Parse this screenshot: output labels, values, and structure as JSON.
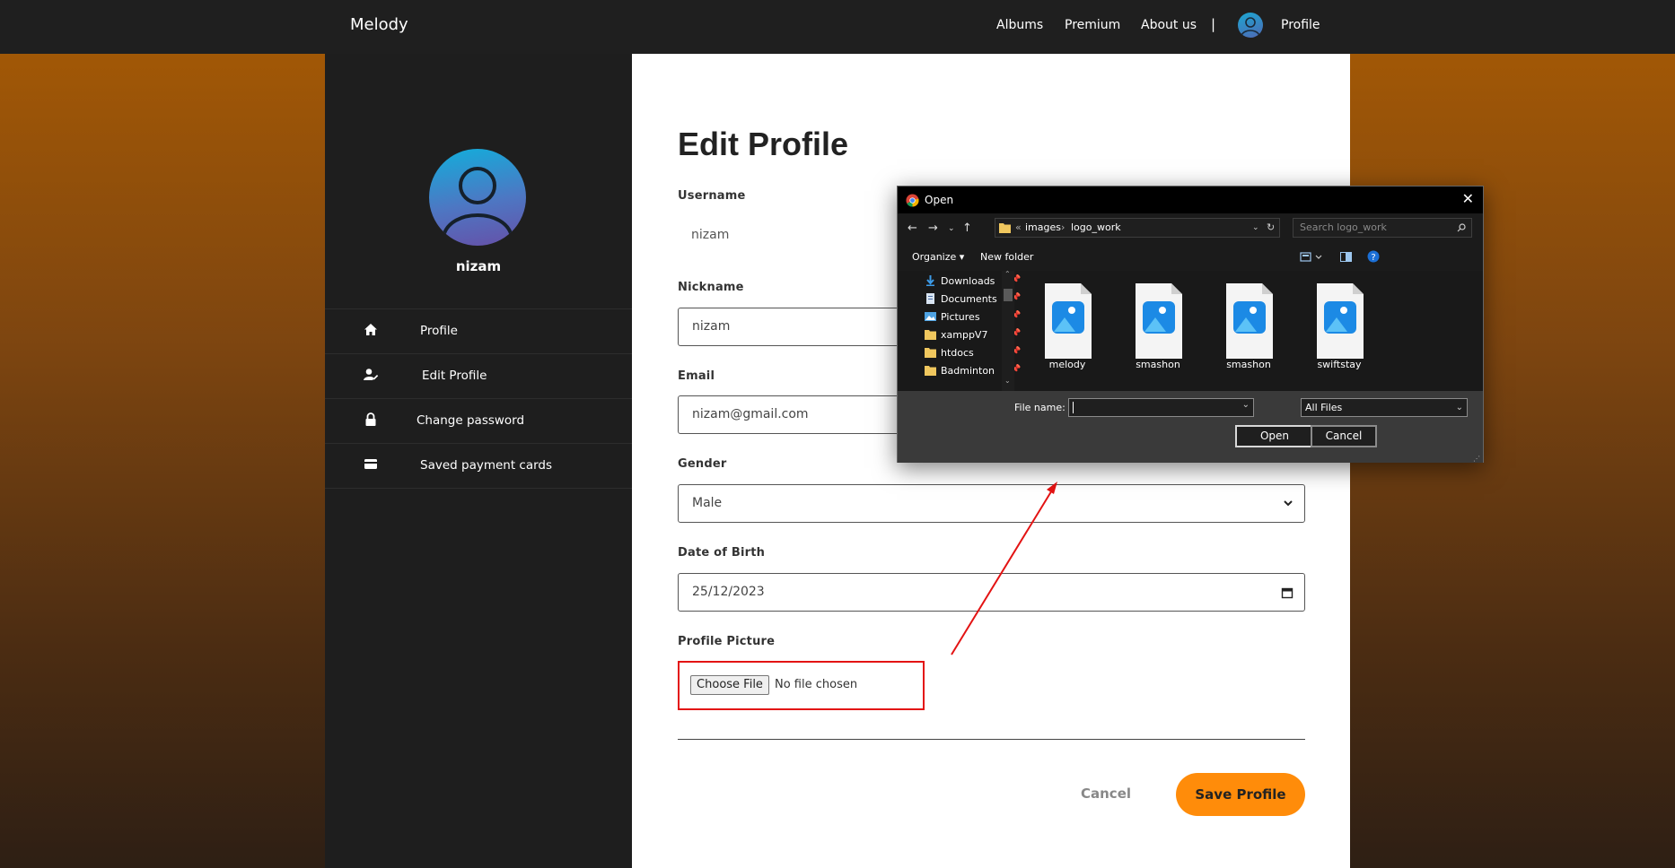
{
  "navbar": {
    "brand": "Melody",
    "links": [
      "Albums",
      "Premium",
      "About us"
    ],
    "separator": "|",
    "profile_label": "Profile"
  },
  "sidebar": {
    "username": "nizam",
    "menu": [
      {
        "label": "Profile",
        "icon": "home-icon"
      },
      {
        "label": "Edit Profile",
        "icon": "user-edit-icon"
      },
      {
        "label": "Change password",
        "icon": "lock-icon"
      },
      {
        "label": "Saved payment cards",
        "icon": "card-icon"
      }
    ]
  },
  "form": {
    "title": "Edit Profile",
    "username_label": "Username",
    "username_value": "nizam",
    "nickname_label": "Nickname",
    "nickname_value": "nizam",
    "email_label": "Email",
    "email_value": "nizam@gmail.com",
    "gender_label": "Gender",
    "gender_value": "Male",
    "dob_label": "Date of Birth",
    "dob_value": "25/12/2023",
    "picture_label": "Profile Picture",
    "choose_file": "Choose File",
    "file_status": "No file chosen",
    "cancel": "Cancel",
    "save": "Save Profile"
  },
  "dialog": {
    "title": "Open",
    "breadcrumb": [
      "«",
      "images",
      "›",
      "logo_work"
    ],
    "search_placeholder": "Search logo_work",
    "organize": "Organize ▾",
    "new_folder": "New folder",
    "tree": [
      {
        "label": "Downloads",
        "icon": "download-icon"
      },
      {
        "label": "Documents",
        "icon": "document-icon"
      },
      {
        "label": "Pictures",
        "icon": "pictures-icon"
      },
      {
        "label": "xamppV7",
        "icon": "folder-icon"
      },
      {
        "label": "htdocs",
        "icon": "folder-icon"
      },
      {
        "label": "BadmintonBo",
        "icon": "folder-icon"
      }
    ],
    "files": [
      "melody",
      "smashon",
      "smashon",
      "swiftstay"
    ],
    "file_name_label": "File name:",
    "file_name_value": "",
    "file_type": "All Files",
    "open": "Open",
    "cancel": "Cancel"
  },
  "colors": {
    "accent": "#ff8c0a",
    "highlight_box": "#e31313",
    "navbar_bg": "#1f1f1f",
    "sidebar_bg": "#1e1e1e"
  }
}
